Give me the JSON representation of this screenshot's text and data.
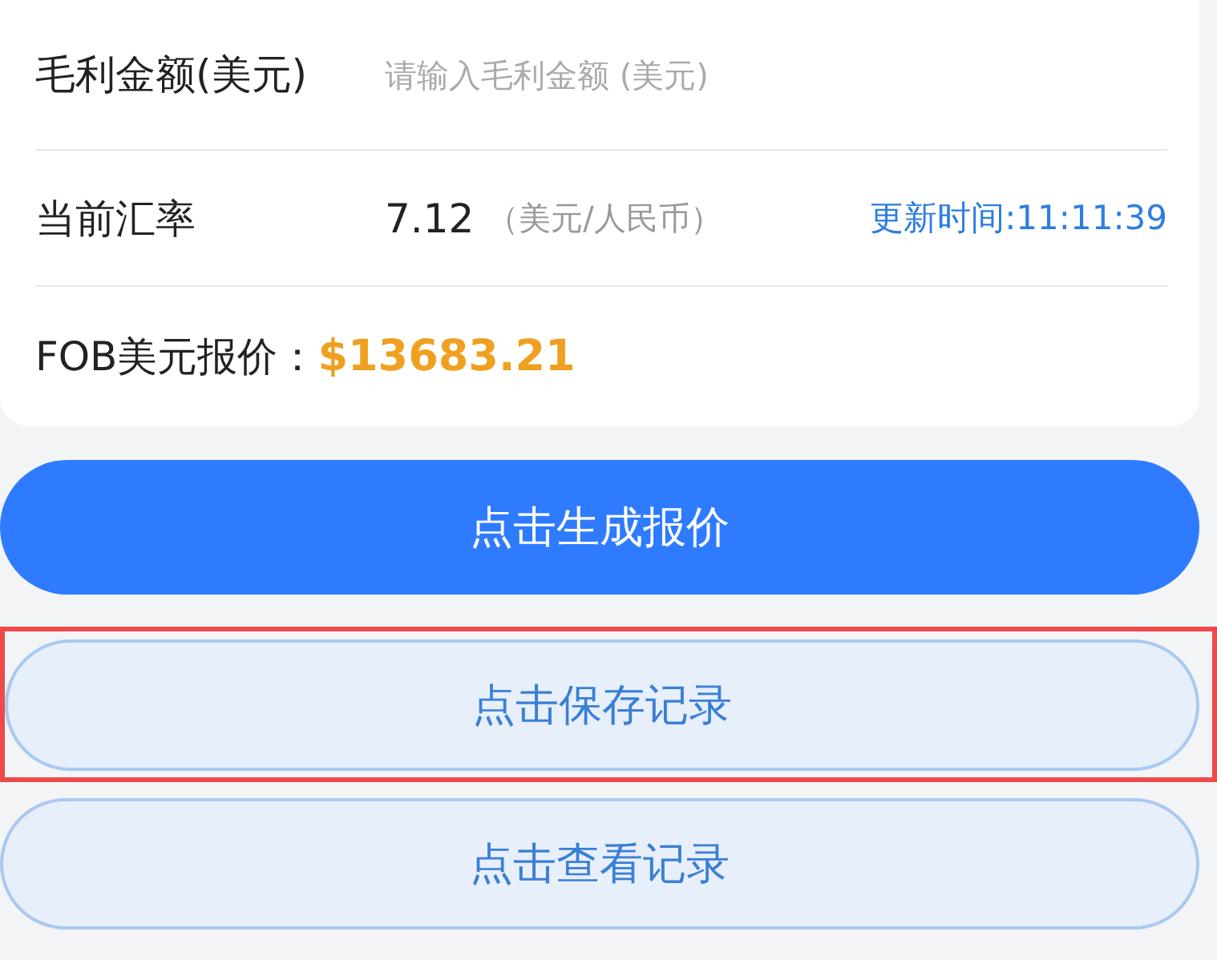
{
  "form": {
    "rows": [
      {
        "kind": "input",
        "label": "毛利金额(美元)",
        "placeholder": "请输入毛利金额 (美元)"
      },
      {
        "kind": "rate",
        "label": "当前汇率",
        "value": "7.12",
        "unit": "（美元/人民币）",
        "updated": "更新时间:11:11:39"
      },
      {
        "kind": "price",
        "label": "FOB美元报价：",
        "value": "$13683.21"
      }
    ]
  },
  "buttons": [
    {
      "label": "点击生成报价",
      "kind": "primary",
      "highlighted": false
    },
    {
      "label": "点击保存记录",
      "kind": "secondary",
      "highlighted": true
    },
    {
      "label": "点击查看记录",
      "kind": "secondary",
      "highlighted": false
    }
  ]
}
